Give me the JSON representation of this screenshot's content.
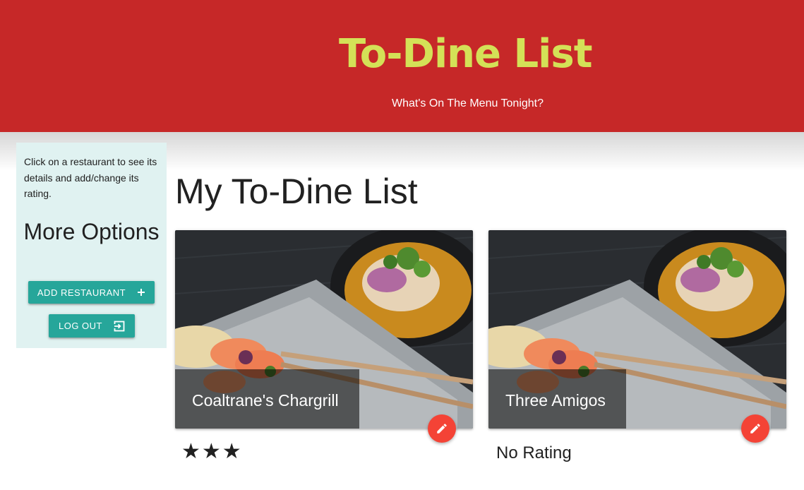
{
  "header": {
    "title": "To-Dine List",
    "subtitle": "What's On The Menu Tonight?"
  },
  "sidebar": {
    "help_text": "Click on a restaurant to see its details and add/change its rating.",
    "heading": "More Options",
    "add_button_label": "ADD RESTAURANT",
    "add_button_icon": "plus-icon",
    "logout_button_label": "LOG OUT",
    "logout_button_icon": "logout-icon"
  },
  "main": {
    "title": "My To-Dine List",
    "restaurants": [
      {
        "name": "Coaltrane's Chargrill",
        "rating": "★★★",
        "edit_icon": "pencil-icon"
      },
      {
        "name": "Three Amigos",
        "rating": "No Rating",
        "edit_icon": "pencil-icon"
      }
    ]
  },
  "colors": {
    "header_bg": "#c62828",
    "title_color": "#d4e157",
    "sidebar_bg": "#e0f2f1",
    "button_bg": "#26a69a",
    "fab_bg": "#f44336"
  }
}
